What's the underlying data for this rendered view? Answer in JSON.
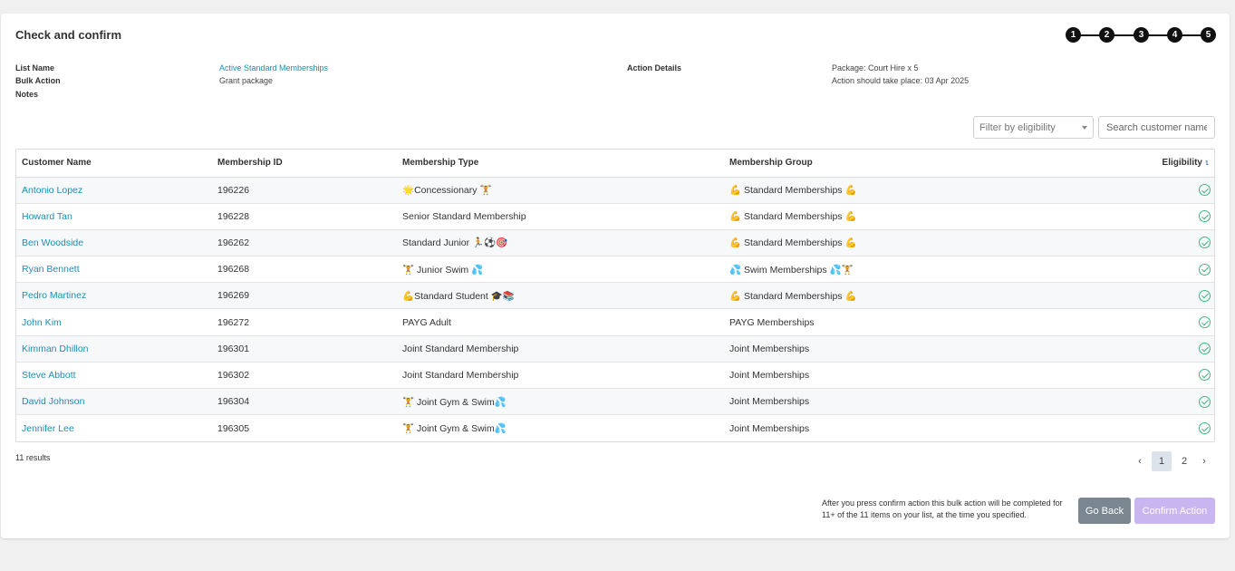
{
  "page": {
    "title": "Check and confirm"
  },
  "stepper": {
    "steps": [
      "1",
      "2",
      "3",
      "4",
      "5"
    ]
  },
  "details": {
    "list_name_label": "List Name",
    "list_name_value": "Active Standard Memberships",
    "bulk_action_label": "Bulk Action",
    "bulk_action_value": "Grant package",
    "notes_label": "Notes",
    "action_details_label": "Action Details",
    "package_line": "Package: Court Hire x 5",
    "date_line": "Action should take place: 03 Apr 2025"
  },
  "filter": {
    "placeholder": "Filter by eligibility",
    "icon": "chevron-down-icon"
  },
  "search": {
    "placeholder": "Search customer name"
  },
  "table": {
    "headers": [
      "Customer Name",
      "Membership ID",
      "Membership Type",
      "Membership Group",
      "Eligibility"
    ],
    "sort_icon": "sort-icon",
    "rows": [
      {
        "name": "Antonio Lopez",
        "id": "196226",
        "type": "🌟Concessionary 🏋",
        "group": "💪 Standard Memberships 💪"
      },
      {
        "name": "Howard Tan",
        "id": "196228",
        "type": "Senior Standard Membership",
        "group": "💪 Standard Memberships 💪"
      },
      {
        "name": "Ben Woodside",
        "id": "196262",
        "type": "Standard Junior 🏃⚽🎯",
        "group": "💪 Standard Memberships 💪"
      },
      {
        "name": "Ryan Bennett",
        "id": "196268",
        "type": "🏋 Junior Swim 💦",
        "group": "💦 Swim Memberships 💦🏋"
      },
      {
        "name": "Pedro Martinez",
        "id": "196269",
        "type": "💪Standard Student 🎓📚",
        "group": "💪 Standard Memberships 💪"
      },
      {
        "name": "John Kim",
        "id": "196272",
        "type": "PAYG Adult",
        "group": "PAYG Memberships"
      },
      {
        "name": "Kimman Dhillon",
        "id": "196301",
        "type": "Joint Standard Membership",
        "group": "Joint Memberships"
      },
      {
        "name": "Steve Abbott",
        "id": "196302",
        "type": "Joint Standard Membership",
        "group": "Joint Memberships"
      },
      {
        "name": "David Johnson",
        "id": "196304",
        "type": "🏋 Joint Gym & Swim💦",
        "group": "Joint Memberships"
      },
      {
        "name": "Jennifer Lee",
        "id": "196305",
        "type": "🏋 Joint Gym & Swim💦",
        "group": "Joint Memberships"
      }
    ],
    "eligible_icon": "check-circle-icon"
  },
  "results": {
    "count_text": "11 results"
  },
  "pagination": {
    "prev": "‹",
    "pages": [
      "1",
      "2"
    ],
    "active": "1",
    "next": "›"
  },
  "footer": {
    "note": "After you press confirm action this bulk action will be completed for 11+ of the 11 items on your list, at the time you specified.",
    "back_label": "Go Back",
    "confirm_label": "Confirm Action"
  },
  "colors": {
    "link": "#1a8fb3",
    "check": "#3fb57d",
    "back_button": "#7a8790",
    "confirm_button": "#c9b5f0"
  }
}
